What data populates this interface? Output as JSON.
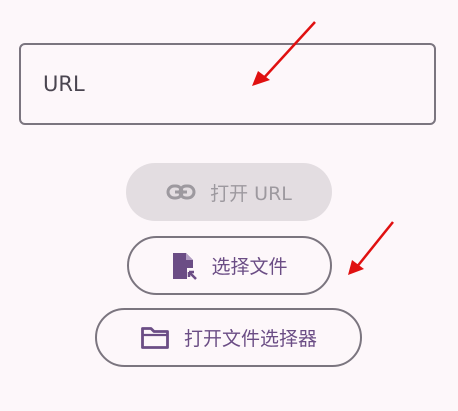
{
  "url_input": {
    "placeholder": "URL",
    "value": ""
  },
  "buttons": {
    "open_url": {
      "label": "打开 URL",
      "icon": "link-icon",
      "enabled": false
    },
    "choose_file": {
      "label": "选择文件",
      "icon": "file-open-icon",
      "enabled": true
    },
    "open_file_picker": {
      "label": "打开文件选择器",
      "icon": "folder-icon",
      "enabled": true
    }
  },
  "colors": {
    "background": "#fdf7fa",
    "outline": "#7b757f",
    "primary": "#6b4d85",
    "disabled_bg": "#e3dde1",
    "disabled_text": "#9d999f",
    "annotation_arrow": "#e01010"
  }
}
